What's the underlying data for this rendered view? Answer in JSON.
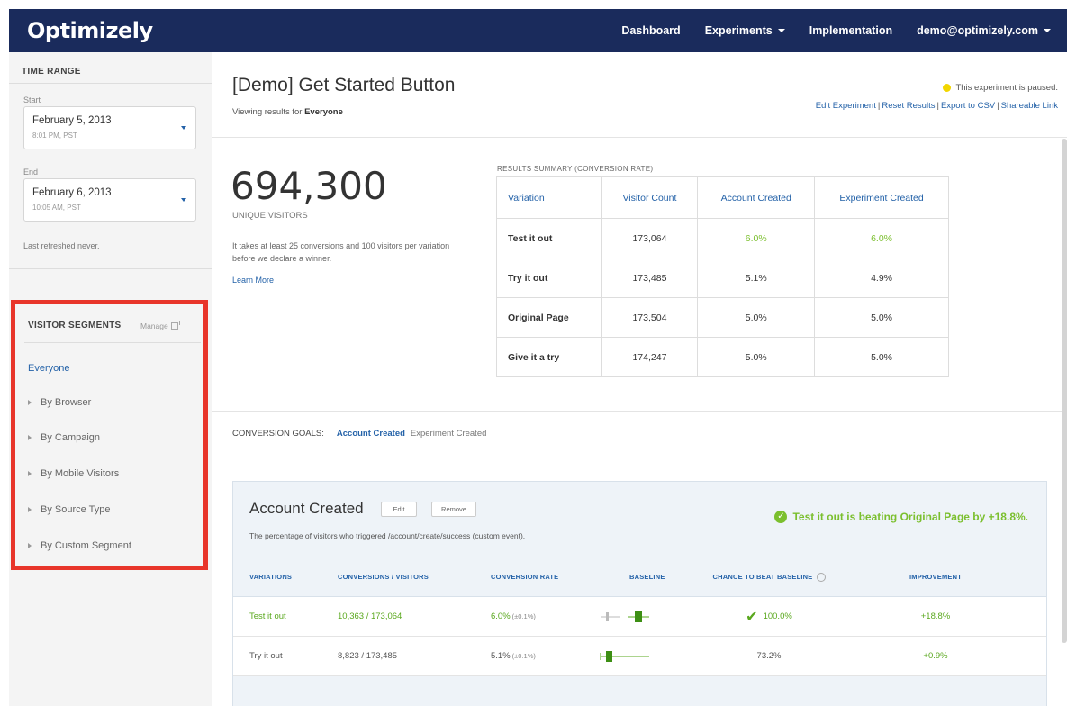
{
  "app": {
    "logo": "Optimizely"
  },
  "nav": {
    "dashboard": "Dashboard",
    "experiments": "Experiments",
    "implementation": "Implementation",
    "account": "demo@optimizely.com"
  },
  "sidebar": {
    "time_range_heading": "TIME RANGE",
    "start_label": "Start",
    "start_date": "February 5, 2013",
    "start_time": "8:01 PM, PST",
    "end_label": "End",
    "end_date": "February 6, 2013",
    "end_time": "10:05 AM, PST",
    "refreshed": "Last refreshed never.",
    "segments_heading": "VISITOR SEGMENTS",
    "manage": "Manage",
    "segments": [
      {
        "label": "Everyone"
      },
      {
        "label": "By Browser"
      },
      {
        "label": "By Campaign"
      },
      {
        "label": "By Mobile Visitors"
      },
      {
        "label": "By Source Type"
      },
      {
        "label": "By Custom Segment"
      }
    ]
  },
  "header": {
    "title": "[Demo] Get Started Button",
    "viewing_prefix": "Viewing results for",
    "viewing_segment": "Everyone",
    "status": "This experiment is paused.",
    "links": [
      "Edit Experiment",
      "Reset Results",
      "Export to CSV",
      "Shareable Link"
    ]
  },
  "summary": {
    "unique_visitors": "694,300",
    "unique_label": "UNIQUE VISITORS",
    "note": "It takes at least 25 conversions and 100 visitors per variation before we declare a winner.",
    "learn_more": "Learn More",
    "table_heading": "RESULTS SUMMARY (CONVERSION RATE)",
    "columns": [
      "Variation",
      "Visitor Count",
      "Account Created",
      "Experiment Created"
    ],
    "rows": [
      {
        "variation": "Test it out",
        "visitors": "173,064",
        "account": "6.0%",
        "experiment": "6.0%"
      },
      {
        "variation": "Try it out",
        "visitors": "173,485",
        "account": "5.1%",
        "experiment": "4.9%"
      },
      {
        "variation": "Original Page",
        "visitors": "173,504",
        "account": "5.0%",
        "experiment": "5.0%"
      },
      {
        "variation": "Give it a try",
        "visitors": "174,247",
        "account": "5.0%",
        "experiment": "5.0%"
      }
    ]
  },
  "goals": {
    "label": "CONVERSION GOALS:",
    "active": "Account Created",
    "inactive": "Experiment Created"
  },
  "goal_card": {
    "title": "Account Created",
    "edit": "Edit",
    "remove": "Remove",
    "description": "The percentage of visitors who triggered /account/create/success (custom event).",
    "beat_message": "Test it out is beating Original Page by +18.8%.",
    "columns": [
      "VARIATIONS",
      "CONVERSIONS / VISITORS",
      "CONVERSION RATE",
      "BASELINE",
      "CHANCE TO BEAT BASELINE",
      "IMPROVEMENT"
    ],
    "rows": [
      {
        "variation": "Test it out",
        "conversions": "10,363 / 173,064",
        "rate": "6.0%",
        "rate_ci": "(±0.1%)",
        "chance": "100.0%",
        "improvement": "+18.8%"
      },
      {
        "variation": "Try it out",
        "conversions": "8,823 / 173,485",
        "rate": "5.1%",
        "rate_ci": "(±0.1%)",
        "chance": "73.2%",
        "improvement": "+0.9%"
      }
    ]
  },
  "colors": {
    "navbar": "#1a2b5c",
    "link": "#2462a8",
    "success": "#7bbf2e",
    "highlight_border": "#e8352a",
    "paused_dot": "#f2d600"
  }
}
